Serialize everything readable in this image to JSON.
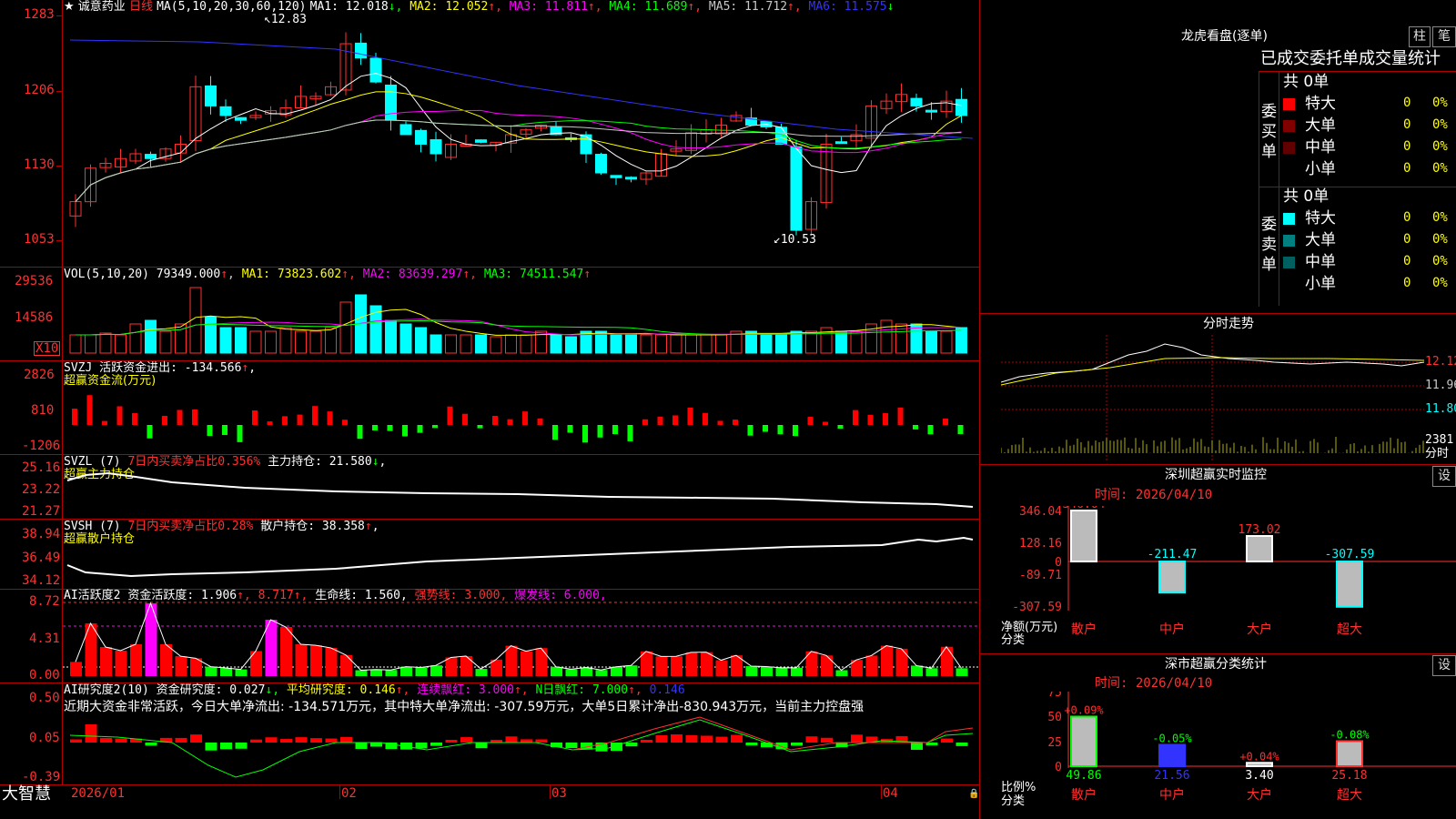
{
  "app": {
    "logo": "大智慧"
  },
  "main": {
    "stock_name": "诚意药业",
    "period": "日线",
    "ma_header": "MA(5,10,20,30,60,120)",
    "ma": [
      {
        "label": "MA1: 12.018",
        "arrow": "↓",
        "color": "#ffffff"
      },
      {
        "label": "MA2: 12.052",
        "arrow": "↑",
        "color": "#ffff00"
      },
      {
        "label": "MA3: 11.811",
        "arrow": "↑",
        "color": "#ff00ff"
      },
      {
        "label": "MA4: 11.689",
        "arrow": "↑",
        "color": "#00ff00"
      },
      {
        "label": "MA5: 11.712",
        "arrow": "↑",
        "color": "#c8c8c8"
      },
      {
        "label": "MA6: 11.575",
        "arrow": "↓",
        "color": "#3333ff"
      }
    ],
    "yaxis": [
      "1283",
      "1206",
      "1130",
      "1053"
    ],
    "high_label": "12.83",
    "low_label": "10.53",
    "xaxis": [
      "2026/01",
      "02",
      "03",
      "04"
    ]
  },
  "vol": {
    "header": "VOL(5,10,20)",
    "value": "79349.000",
    "arrow": "↑",
    "ma1": "MA1: 73823.602",
    "ma2": "MA2: 83639.297",
    "ma3": "MA3: 74511.547",
    "yaxis": [
      "29536",
      "14586"
    ],
    "unit": "X10"
  },
  "svzj": {
    "header": "SVZJ  活跃资金进出: -134.566",
    "arrow": "↑",
    "sub": "超赢资金流(万元)",
    "yaxis": [
      "2826",
      "810",
      "-1206"
    ]
  },
  "svzl": {
    "header": "SVZL (7)",
    "ratio": "7日内买卖净占比0.356%",
    "hold": "主力持仓: 21.580",
    "arrow": "↓",
    "sub": "超赢主力持仓",
    "yaxis": [
      "25.16",
      "23.22",
      "21.27"
    ]
  },
  "svsh": {
    "header": "SVSH (7)",
    "ratio": "7日内买卖净占比0.28%",
    "hold": "散户持仓: 38.358",
    "arrow": "↑",
    "sub": "超赢散户持仓",
    "yaxis": [
      "38.94",
      "36.49",
      "34.12"
    ]
  },
  "ai1": {
    "header": "AI活跃度2",
    "a": "资金活跃度: 1.906",
    "b": "8.717",
    "c": "生命线: 1.560,",
    "d": "强势线: 3.000,",
    "e": "爆发线: 6.000,",
    "yaxis": [
      "8.72",
      "4.31",
      "0.00"
    ]
  },
  "ai2": {
    "header": "AI研究度2(10)",
    "a": "资金研究度: 0.027",
    "b": "平均研究度: 0.146",
    "c": "连续飘红: 3.000",
    "d": "N日飘红: 7.000",
    "e": "0.146",
    "text": "近期大资金非常活跃，今日大单净流出: -134.571万元，其中特大单净流出: -307.59万元，大单5日累计净出-830.943万元，当前主力控盘强",
    "yaxis": [
      "0.50",
      "0.05",
      "-0.39"
    ]
  },
  "right": {
    "title": "龙虎看盘(逐单)",
    "btn_bar": "柱",
    "btn_pen": "笔",
    "tabs": [
      "已成交",
      "委托单",
      "成交量统计"
    ],
    "buy": {
      "label": "委买单",
      "total": "共 0单",
      "rows": [
        {
          "name": "特大",
          "v": "0",
          "p": "0%",
          "color": "#ff0000"
        },
        {
          "name": "大单",
          "v": "0",
          "p": "0%",
          "color": "#800000"
        },
        {
          "name": "中单",
          "v": "0",
          "p": "0%",
          "color": "#600000"
        },
        {
          "name": "小单",
          "v": "0",
          "p": "0%",
          "color": ""
        }
      ]
    },
    "sell": {
      "label": "委卖单",
      "total": "共 0单",
      "rows": [
        {
          "name": "特大",
          "v": "0",
          "p": "0%",
          "color": "#00ffff"
        },
        {
          "name": "大单",
          "v": "0",
          "p": "0%",
          "color": "#008080"
        },
        {
          "name": "中单",
          "v": "0",
          "p": "0%",
          "color": "#006060"
        },
        {
          "name": "小单",
          "v": "0",
          "p": "0%",
          "color": ""
        }
      ]
    },
    "fenshi": {
      "title": "分时走势",
      "price_labels": [
        "12.12",
        "11.96",
        "11.80"
      ],
      "vol_label": "2381",
      "unit_label": "分时"
    },
    "monitor": {
      "title": "深圳超赢实时监控",
      "set": "设",
      "time": "时间: 2026/04/10",
      "yaxis": [
        "346.04",
        "128.16",
        "0",
        "-89.71",
        "-307.59"
      ],
      "ylabel": "净额(万元)",
      "xlabel": "分类",
      "bars": [
        {
          "cat": "散户",
          "value": "346.04"
        },
        {
          "cat": "中户",
          "value": "-211.47"
        },
        {
          "cat": "大户",
          "value": "173.02"
        },
        {
          "cat": "超大",
          "value": "-307.59"
        }
      ]
    },
    "stats": {
      "title": "深市超赢分类统计",
      "set": "设",
      "time": "时间: 2026/04/10",
      "yaxis": [
        "75",
        "50",
        "25",
        "0"
      ],
      "ylabel": "比例%",
      "xlabel": "分类",
      "bars": [
        {
          "cat": "散户",
          "pct": "49.86",
          "chg": "+0.09%"
        },
        {
          "cat": "中户",
          "pct": "21.56",
          "chg": "-0.05%"
        },
        {
          "cat": "大户",
          "pct": "3.40",
          "chg": "+0.04%"
        },
        {
          "cat": "超大",
          "pct": "25.18",
          "chg": "-0.08%"
        }
      ]
    }
  }
}
